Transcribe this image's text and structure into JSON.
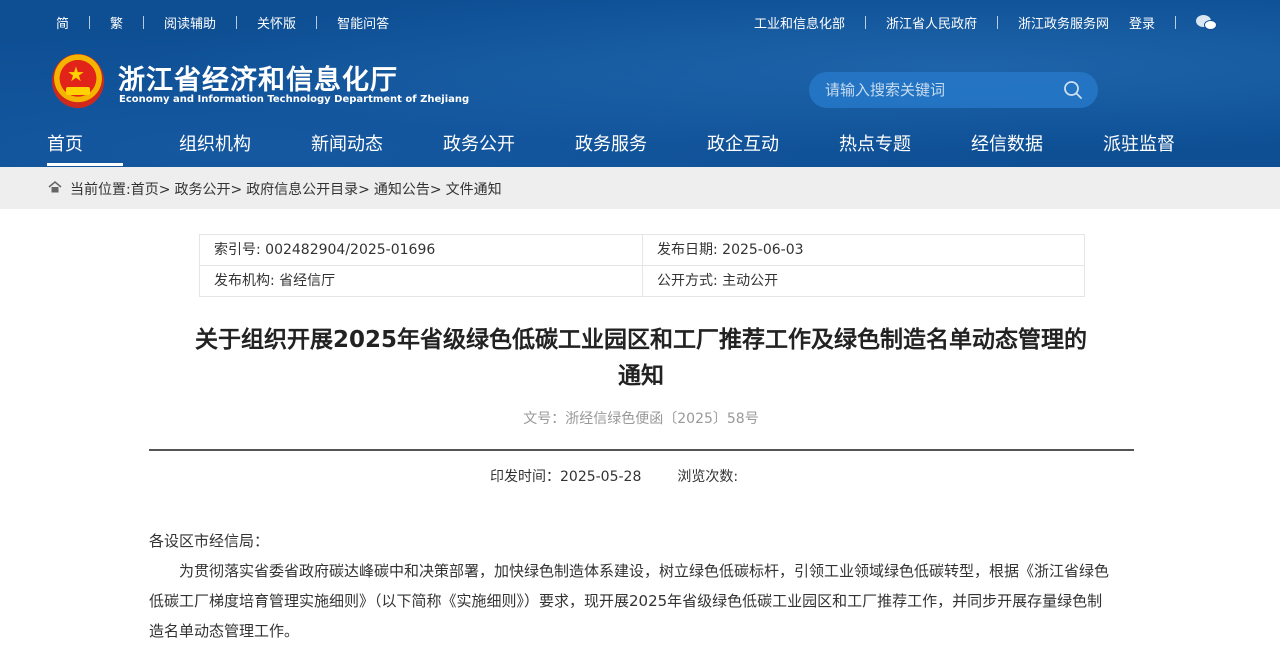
{
  "topbar": {
    "left_links": [
      "简",
      "繁",
      "阅读辅助",
      "关怀版",
      "智能问答"
    ],
    "right_links": [
      "工业和信息化部",
      "浙江省人民政府",
      "浙江政务服务网",
      "登录"
    ]
  },
  "site": {
    "title": "浙江省经济和信息化厅",
    "subtitle": "Economy and Information Technology Department of Zhejiang"
  },
  "search": {
    "placeholder": "请输入搜索关键词"
  },
  "nav": [
    "首页",
    "组织机构",
    "新闻动态",
    "政务公开",
    "政务服务",
    "政企互动",
    "热点专题",
    "经信数据",
    "派驻监督"
  ],
  "breadcrumb": {
    "prefix": "当前位置:",
    "items": [
      "首页>",
      "政务公开>",
      "政府信息公开目录>",
      "通知公告>",
      "文件通知"
    ]
  },
  "meta": {
    "index_no": "索引号: 002482904/2025-01696",
    "publish_date": "发布日期: 2025-06-03",
    "issuer": "发布机构: 省经信厅",
    "disclosure": "公开方式: 主动公开"
  },
  "document": {
    "title_line1": "关于组织开展2025年省级绿色低碳工业园区和工厂推荐工作及绿色制造名单动态管理的",
    "title_line2": "通知",
    "doc_number": "文号：浙经信绿色便函〔2025〕58号",
    "issued_time": "印发时间：2025-05-28",
    "views_label": "浏览次数:",
    "salutation": "各设区市经信局：",
    "paragraph1_line1": "为贯彻落实省委省政府碳达峰碳中和决策部署，加快绿色制造体系建设，树立绿色低碳标杆，引领工业领域绿色低碳转型，根据《浙江省绿色",
    "paragraph1_line2": "低碳工厂梯度培育管理实施细则》（以下简称《实施细则》）要求，现开展2025年省级绿色低碳工业园区和工厂推荐工作，并同步开展存量绿色制",
    "paragraph1_line3": "造名单动态管理工作。"
  }
}
